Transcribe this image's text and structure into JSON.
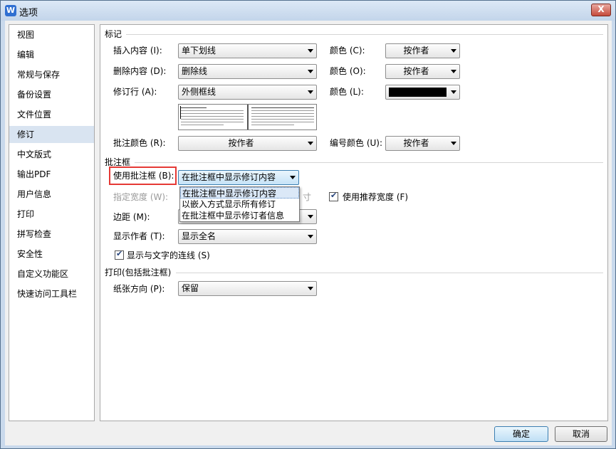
{
  "window": {
    "title": "选项",
    "app_icon": "W",
    "close_glyph": "X"
  },
  "sidebar": {
    "items": [
      {
        "label": "视图"
      },
      {
        "label": "编辑"
      },
      {
        "label": "常规与保存"
      },
      {
        "label": "备份设置"
      },
      {
        "label": "文件位置"
      },
      {
        "label": "修订",
        "selected": true
      },
      {
        "label": "中文版式"
      },
      {
        "label": "输出PDF"
      },
      {
        "label": "用户信息"
      },
      {
        "label": "打印"
      },
      {
        "label": "拼写检查"
      },
      {
        "label": "安全性"
      },
      {
        "label": "自定义功能区"
      },
      {
        "label": "快速访问工具栏"
      }
    ]
  },
  "markup": {
    "heading": "标记",
    "insert_label": "插入内容 (I):",
    "insert_value": "单下划线",
    "delete_label": "删除内容 (D):",
    "delete_value": "删除线",
    "revline_label": "修订行 (A):",
    "revline_value": "外侧框线",
    "color_c_label": "颜色 (C):",
    "color_c_value": "按作者",
    "color_o_label": "颜色 (O):",
    "color_o_value": "按作者",
    "color_l_label": "颜色 (L):",
    "color_l_swatch": "#000000",
    "comment_color_label": "批注颜色 (R):",
    "comment_color_value": "按作者",
    "number_color_label": "编号颜色 (U):",
    "number_color_value": "按作者"
  },
  "balloons": {
    "heading": "批注框",
    "use_label": "使用批注框 (B):",
    "use_value": "在批注框中显示修订内容",
    "dropdown_options": [
      "在批注框中显示修订内容",
      "以嵌入方式显示所有修订",
      "在批注框中显示修订者信息"
    ],
    "width_label": "指定宽度 (W):",
    "width_unit_partial": "寸",
    "recommend_width_label": "使用推荐宽度 (F)",
    "recommend_width_checked": true,
    "margin_label": "边距 (M):",
    "author_label": "显示作者 (T):",
    "author_value": "显示全名",
    "lines_label": "显示与文字的连线 (S)",
    "lines_checked": true
  },
  "print": {
    "heading": "打印(包括批注框)",
    "orientation_label": "纸张方向 (P):",
    "orientation_value": "保留"
  },
  "buttons": {
    "ok": "确定",
    "cancel": "取消"
  },
  "colors": {
    "highlight": "#e53935",
    "selection": "#d9e4f1"
  }
}
